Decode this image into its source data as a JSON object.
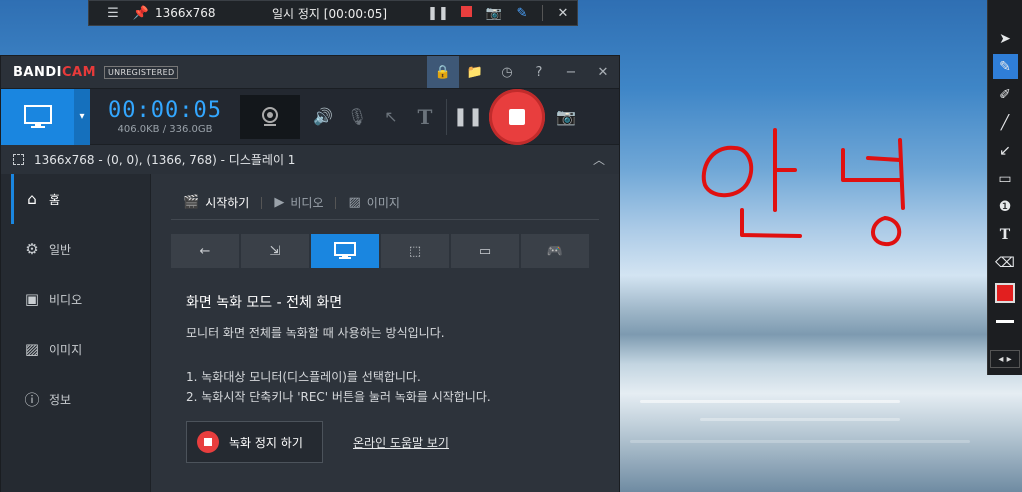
{
  "capture_bar": {
    "resolution": "1366x768",
    "status": "일시 정지 [00:00:05]"
  },
  "window": {
    "logo_prefix": "BANDI",
    "logo_suffix": "CAM",
    "badge": "UNREGISTERED"
  },
  "toolbar": {
    "timer": "00:00:05",
    "size": "406.0KB / 336.0GB"
  },
  "area": {
    "text": "1366x768 - (0, 0), (1366, 768) - 디스플레이 1"
  },
  "sidebar": {
    "items": [
      {
        "label": "홈",
        "icon": "home-icon"
      },
      {
        "label": "일반",
        "icon": "gear-icon"
      },
      {
        "label": "비디오",
        "icon": "video-icon"
      },
      {
        "label": "이미지",
        "icon": "image-icon"
      },
      {
        "label": "정보",
        "icon": "info-icon"
      }
    ]
  },
  "tabs": [
    {
      "label": "시작하기"
    },
    {
      "label": "비디오"
    },
    {
      "label": "이미지"
    }
  ],
  "content": {
    "heading": "화면 녹화 모드 - 전체 화면",
    "description": "모니터 화면 전체를 녹화할 때 사용하는 방식입니다.",
    "step1": "1. 녹화대상 모니터(디스플레이)를 선택합니다.",
    "step2": "2. 녹화시작 단축키나 'REC' 버튼을 눌러 녹화를 시작합니다.",
    "stop_button": "녹화 정지 하기",
    "help_link": "온라인 도움말 보기"
  },
  "palette": {
    "color": "#e21f1f"
  },
  "drawing": {
    "text": "안녕",
    "color": "#e01010"
  },
  "colors": {
    "accent": "#1a86e0",
    "record": "#e83e3e"
  }
}
